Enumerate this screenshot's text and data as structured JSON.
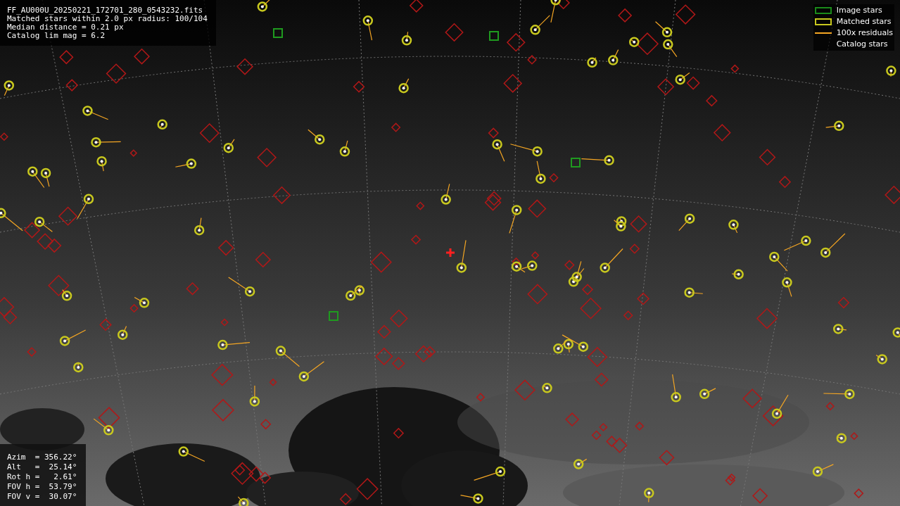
{
  "header_lines": [
    "FF_AU000U_20250221_172701_280_0543232.fits",
    "Matched stars within 2.0 px radius: 100/104",
    "Median distance = 0.21 px",
    "Catalog lim mag = 6.2"
  ],
  "legend": [
    {
      "label": "Image stars"
    },
    {
      "kind": "matched",
      "label": "Matched stars"
    },
    {
      "kind": "residual",
      "label": "100x residuals"
    },
    {
      "kind": "catalog",
      "label": "Catalog stars"
    }
  ],
  "pointing": [
    "Azim  = 356.22°",
    "Alt   =  25.14°",
    "Rot h =   2.61°",
    "FOV h =  53.79°",
    "FOV v =  30.07°"
  ]
}
